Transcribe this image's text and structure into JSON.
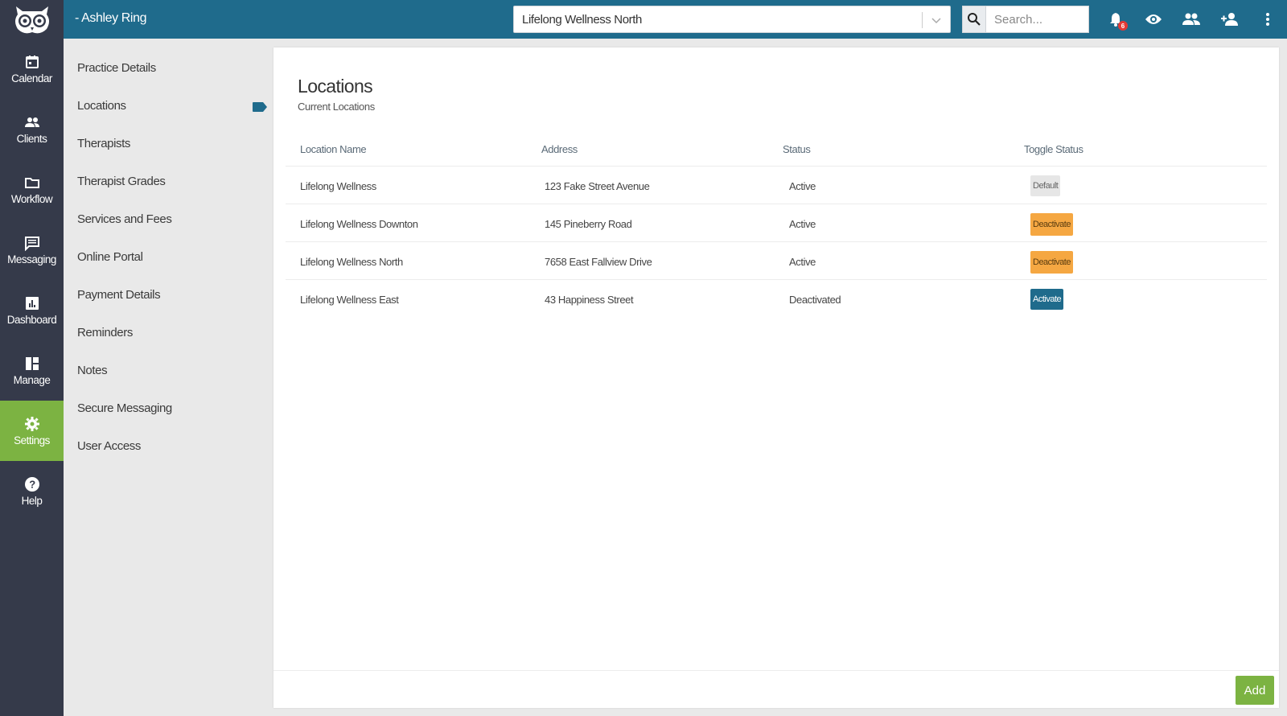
{
  "topbar": {
    "user_name": "- Ashley Ring",
    "location_selected": "Lifelong Wellness North",
    "search_placeholder": "Search...",
    "notification_count": "6"
  },
  "nav": {
    "items": [
      {
        "label": "Calendar",
        "icon": "calendar-icon"
      },
      {
        "label": "Clients",
        "icon": "clients-icon"
      },
      {
        "label": "Workflow",
        "icon": "folder-icon"
      },
      {
        "label": "Messaging",
        "icon": "message-icon"
      },
      {
        "label": "Dashboard",
        "icon": "chart-icon"
      },
      {
        "label": "Manage",
        "icon": "layout-icon"
      },
      {
        "label": "Settings",
        "icon": "gear-icon"
      },
      {
        "label": "Help",
        "icon": "help-icon"
      }
    ],
    "active": "Settings",
    "active_color": "#7cb342"
  },
  "settings_menu": {
    "items": [
      "Practice Details",
      "Locations",
      "Therapists",
      "Therapist Grades",
      "Services and Fees",
      "Online Portal",
      "Payment Details",
      "Reminders",
      "Notes",
      "Secure Messaging",
      "User Access"
    ],
    "active": "Locations"
  },
  "main": {
    "title": "Locations",
    "subtitle": "Current Locations",
    "columns": [
      "Location Name",
      "Address",
      "Status",
      "Toggle Status"
    ],
    "rows": [
      {
        "name": "Lifelong Wellness",
        "address": "123 Fake Street Avenue",
        "status": "Active",
        "action": "Default"
      },
      {
        "name": "Lifelong Wellness Downton",
        "address": "145 Pineberry Road",
        "status": "Active",
        "action": "Deactivate"
      },
      {
        "name": "Lifelong Wellness North",
        "address": "7658 East Fallview Drive",
        "status": "Active",
        "action": "Deactivate"
      },
      {
        "name": "Lifelong Wellness East",
        "address": "43 Happiness Street",
        "status": "Deactivated",
        "action": "Activate"
      }
    ],
    "add_label": "Add"
  },
  "colors": {
    "topbar": "#1f6b8c",
    "leftnav": "#353a4a",
    "accent_green": "#7cb342",
    "deactivate_orange": "#f5a742",
    "activate_blue": "#1f6b8c"
  }
}
